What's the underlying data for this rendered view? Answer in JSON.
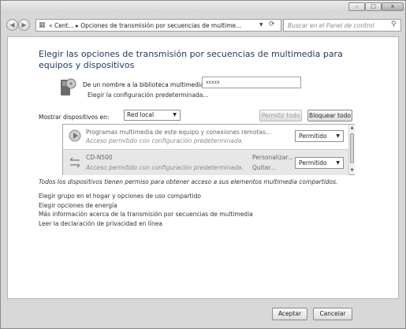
{
  "titlebar": {
    "minimize_glyph": "–",
    "maximize_glyph": "□",
    "close_glyph": "x"
  },
  "nav": {
    "back_glyph": "◀",
    "forward_glyph": "▶",
    "address": "« Cent... ▸ Opciones de transmisión por secuencias de multime...",
    "address_icon": "control-panel-icon",
    "search_placeholder": "Buscar en el Panel de control"
  },
  "main": {
    "heading": "Elegir las opciones de transmisión por secuencias de multimedia para equipos y dispositivos",
    "library_label": "De un nombre a la biblioteca multimedia:",
    "library_value": "xxxxx",
    "library_defaults_link": "Elegir la configuración predeterminada...",
    "show_devices_label": "Mostrar dispositivos en:",
    "show_devices_value": "Red local",
    "allow_all_button": "Permitir todo",
    "block_all_button": "Bloquear todo"
  },
  "devices": [
    {
      "name": "Programas multimedia de este equipo y conexiones remotas...",
      "description": "Acceso permitido con configuración predeterminada.",
      "status": "Permitido",
      "icon": "media-player-icon"
    },
    {
      "name": "CD-N500",
      "description": "Acceso permitido con configuración predeterminada.",
      "customize_link": "Personalizar...",
      "remove_link": "Quitar...",
      "status": "Permitido",
      "icon": "network-device-icon"
    }
  ],
  "note": "Todos los dispositivos tienen permiso para obtener acceso a sus elementos multimedia compartidos.",
  "links": [
    "Elegir grupo en el hogar y opciones de uso compartido",
    "Elegir opciones de energía",
    "Más información acerca de la transmisión por secuencias de multimedia",
    "Leer la declaración de privacidad en línea"
  ],
  "footer": {
    "accept_button": "Aceptar",
    "cancel_button": "Cancelar"
  },
  "colors": {
    "heading": "#1f3b63",
    "selected_row": "#e7e7e7",
    "window_frame": "#d8d8d8"
  }
}
